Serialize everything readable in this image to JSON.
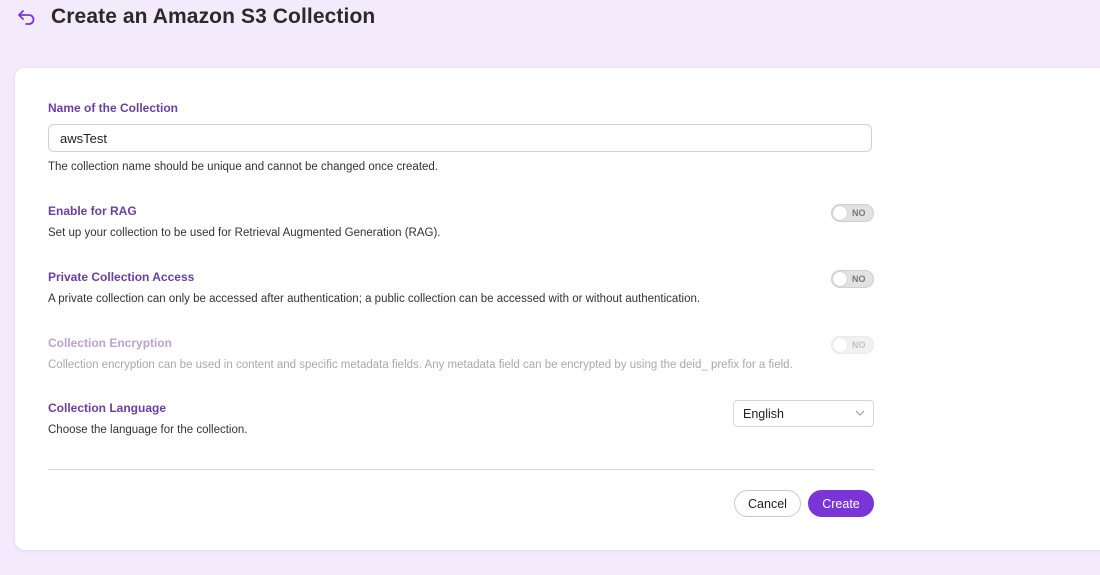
{
  "page": {
    "title": "Create an Amazon S3 Collection"
  },
  "form": {
    "name": {
      "label": "Name of the Collection",
      "value": "awsTest",
      "help": "The collection name should be unique and cannot be changed once created."
    },
    "rag": {
      "label": "Enable for RAG",
      "help": "Set up your collection to be used for Retrieval Augmented Generation (RAG).",
      "toggle": "NO"
    },
    "private_access": {
      "label": "Private Collection Access",
      "help": "A private collection can only be accessed after authentication; a public collection can be accessed with or without authentication.",
      "toggle": "NO"
    },
    "encryption": {
      "label": "Collection Encryption",
      "help": "Collection encryption can be used in content and specific metadata fields. Any metadata field can be encrypted by using the deid_ prefix for a field.",
      "toggle": "NO"
    },
    "language": {
      "label": "Collection Language",
      "help": "Choose the language for the collection.",
      "selected": "English"
    }
  },
  "actions": {
    "cancel_label": "Cancel",
    "create_label": "Create"
  },
  "colors": {
    "accent": "#7a35d9",
    "label": "#6b3fa0",
    "background": "#f3ebfc"
  },
  "icons": {
    "back": "back-arrow-icon",
    "dropdown": "chevron-down-icon"
  }
}
